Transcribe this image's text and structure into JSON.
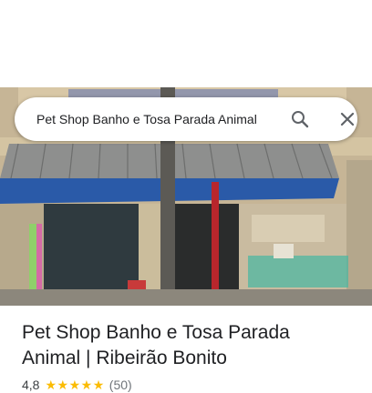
{
  "search": {
    "query": "Pet Shop Banho e Tosa Parada Animal"
  },
  "place": {
    "title_line1": "Pet Shop Banho e Tosa Parada",
    "title_line2": "Animal | Ribeirão Bonito",
    "rating": "4,8",
    "review_count": "(50)",
    "stars": 5,
    "star_glyph": "★",
    "star_color": "#fbbc04"
  },
  "icons": {
    "search": "search-icon",
    "close": "close-icon"
  }
}
